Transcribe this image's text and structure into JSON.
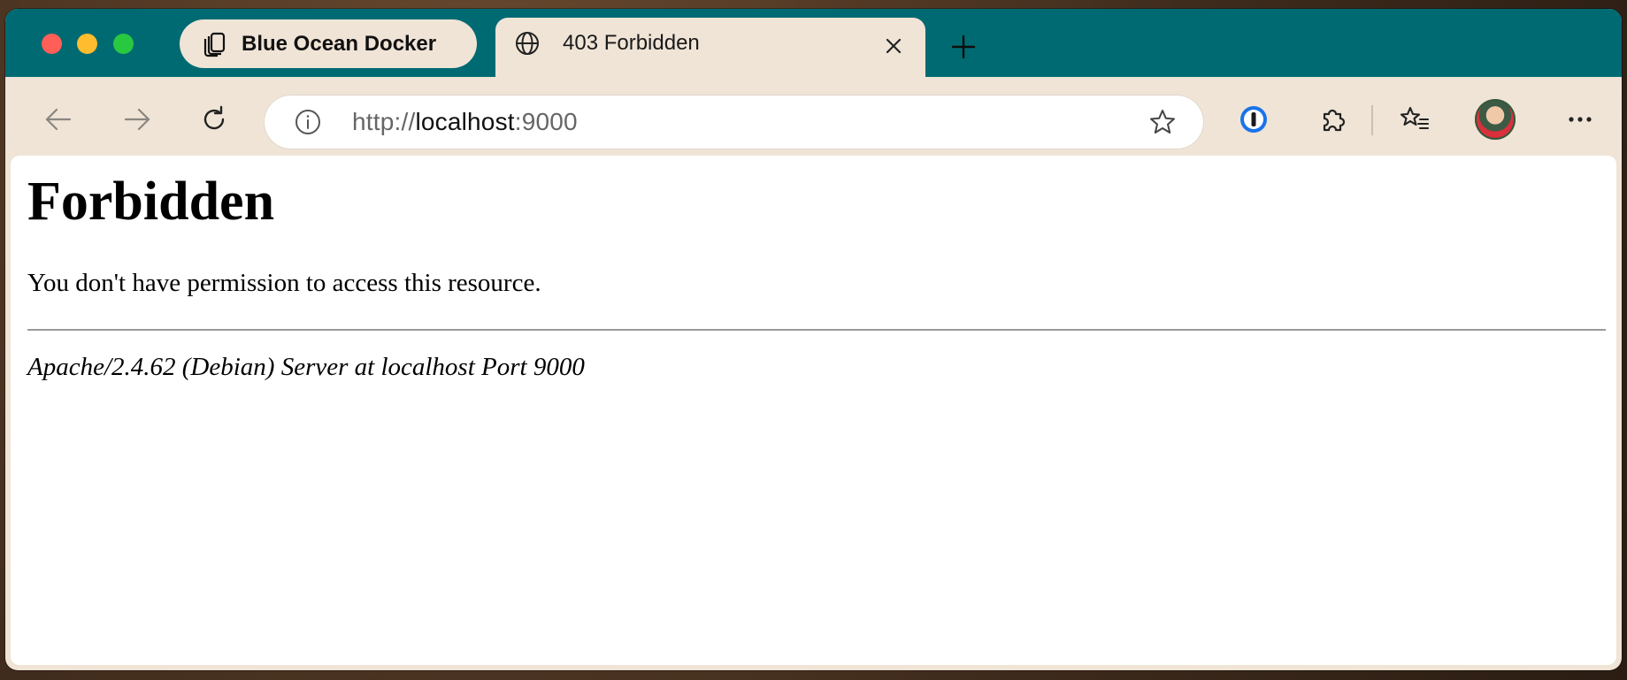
{
  "browser": {
    "tabs": [
      {
        "label": "Blue Ocean Docker",
        "icon": "tab-group-icon",
        "pinned": true
      },
      {
        "label": "403 Forbidden",
        "icon": "globe-icon",
        "active": true
      }
    ],
    "address": {
      "scheme": "http://",
      "host": "localhost",
      "port": ":9000"
    },
    "colors": {
      "tabbar": "#006a72",
      "chrome": "#efe4d6"
    }
  },
  "page": {
    "heading": "Forbidden",
    "message": "You don't have permission to access this resource.",
    "server_signature": "Apache/2.4.62 (Debian) Server at localhost Port 9000"
  }
}
